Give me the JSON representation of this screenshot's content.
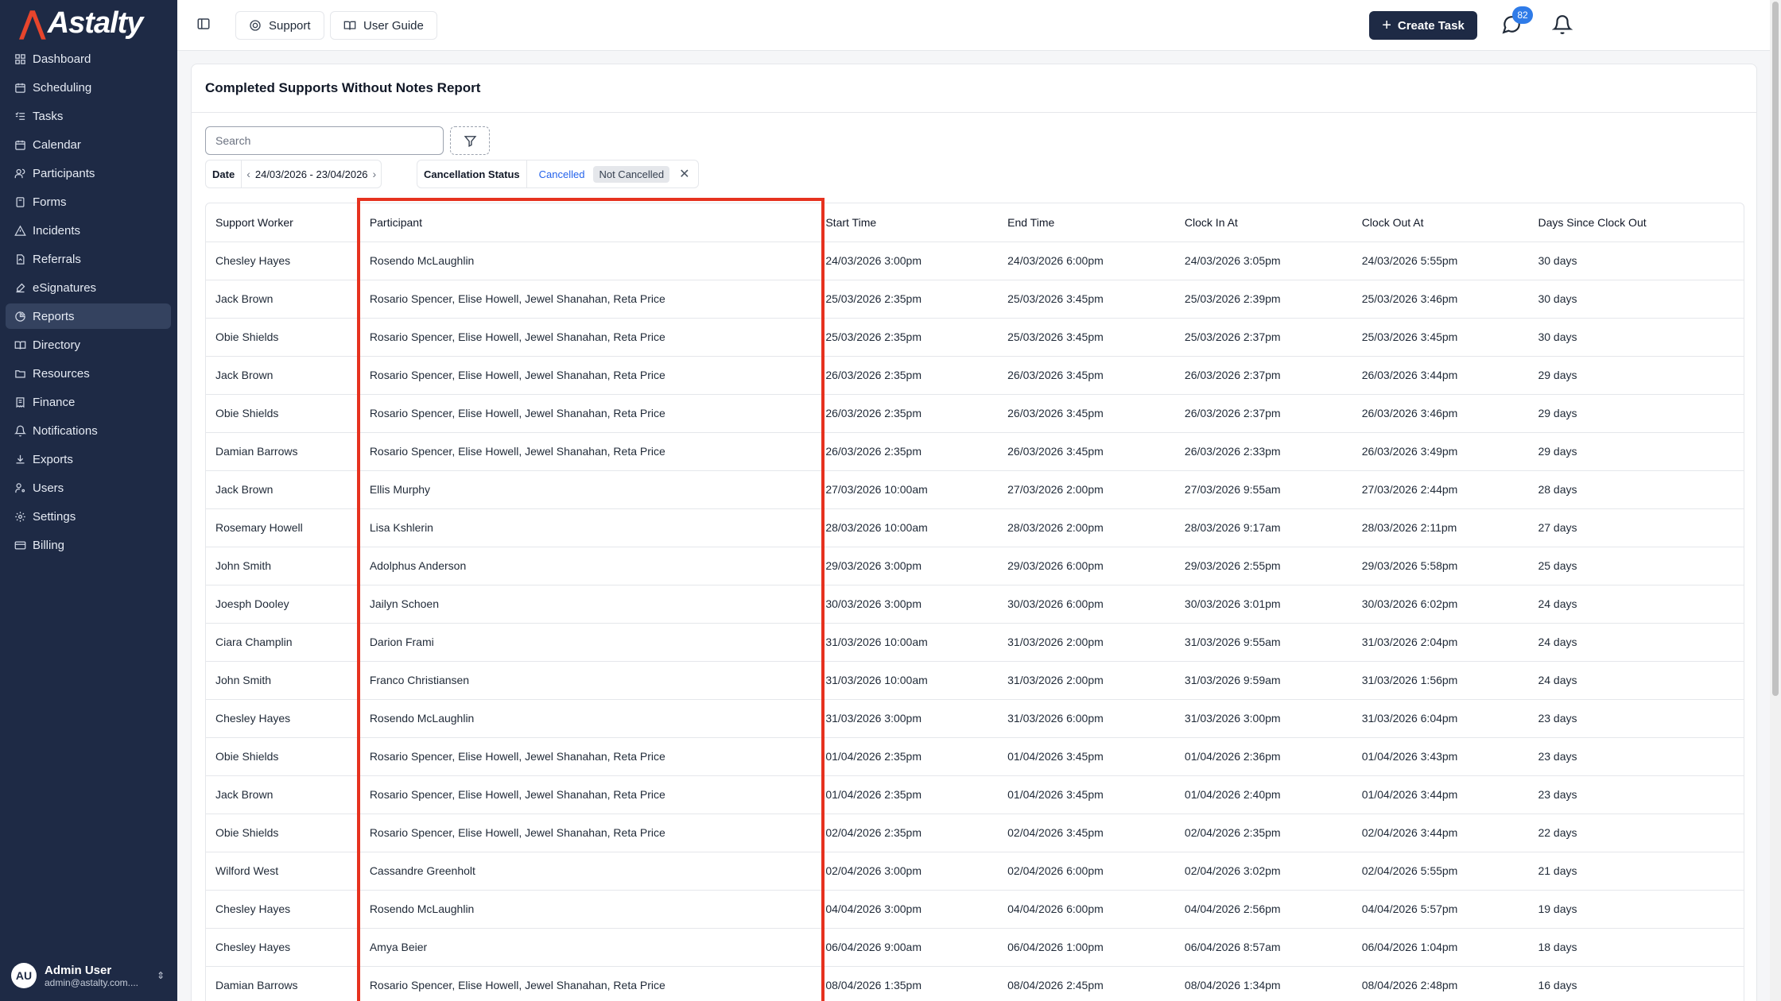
{
  "app": {
    "logo_text": "Astalty"
  },
  "sidebar": {
    "items": [
      {
        "label": "Dashboard",
        "icon": "dashboard-icon",
        "active": false
      },
      {
        "label": "Scheduling",
        "icon": "calendar-clock-icon",
        "active": false
      },
      {
        "label": "Tasks",
        "icon": "tasks-icon",
        "active": false
      },
      {
        "label": "Calendar",
        "icon": "calendar-icon",
        "active": false
      },
      {
        "label": "Participants",
        "icon": "users-icon",
        "active": false
      },
      {
        "label": "Forms",
        "icon": "form-icon",
        "active": false
      },
      {
        "label": "Incidents",
        "icon": "warning-icon",
        "active": false
      },
      {
        "label": "Referrals",
        "icon": "referral-icon",
        "active": false
      },
      {
        "label": "eSignatures",
        "icon": "signature-icon",
        "active": false
      },
      {
        "label": "Reports",
        "icon": "pie-chart-icon",
        "active": true
      },
      {
        "label": "Directory",
        "icon": "book-icon",
        "active": false
      },
      {
        "label": "Resources",
        "icon": "folder-icon",
        "active": false
      },
      {
        "label": "Finance",
        "icon": "receipt-icon",
        "active": false
      },
      {
        "label": "Notifications",
        "icon": "bell-icon",
        "active": false
      },
      {
        "label": "Exports",
        "icon": "download-icon",
        "active": false
      },
      {
        "label": "Users",
        "icon": "user-key-icon",
        "active": false
      },
      {
        "label": "Settings",
        "icon": "gear-icon",
        "active": false
      },
      {
        "label": "Billing",
        "icon": "credit-card-icon",
        "active": false
      }
    ],
    "user": {
      "initials": "AU",
      "name": "Admin User",
      "email": "admin@astalty.com...."
    }
  },
  "topbar": {
    "support_label": "Support",
    "guide_label": "User Guide",
    "create_label": "Create Task",
    "messages_count": "82"
  },
  "report": {
    "title": "Completed Supports Without Notes Report",
    "search_placeholder": "Search",
    "date_filter": {
      "label": "Date",
      "range": "24/03/2026 - 23/04/2026"
    },
    "status_filter": {
      "label": "Cancellation Status",
      "options": [
        "Cancelled",
        "Not Cancelled"
      ],
      "selected": "Not Cancelled"
    },
    "columns": [
      "Support Worker",
      "Participant",
      "Start Time",
      "End Time",
      "Clock In At",
      "Clock Out At",
      "Days Since Clock Out"
    ],
    "rows": [
      [
        "Chesley Hayes",
        "Rosendo McLaughlin",
        "24/03/2026 3:00pm",
        "24/03/2026 6:00pm",
        "24/03/2026 3:05pm",
        "24/03/2026 5:55pm",
        "30 days"
      ],
      [
        "Jack Brown",
        "Rosario Spencer, Elise Howell, Jewel Shanahan, Reta Price",
        "25/03/2026 2:35pm",
        "25/03/2026 3:45pm",
        "25/03/2026 2:39pm",
        "25/03/2026 3:46pm",
        "30 days"
      ],
      [
        "Obie Shields",
        "Rosario Spencer, Elise Howell, Jewel Shanahan, Reta Price",
        "25/03/2026 2:35pm",
        "25/03/2026 3:45pm",
        "25/03/2026 2:37pm",
        "25/03/2026 3:45pm",
        "30 days"
      ],
      [
        "Jack Brown",
        "Rosario Spencer, Elise Howell, Jewel Shanahan, Reta Price",
        "26/03/2026 2:35pm",
        "26/03/2026 3:45pm",
        "26/03/2026 2:37pm",
        "26/03/2026 3:44pm",
        "29 days"
      ],
      [
        "Obie Shields",
        "Rosario Spencer, Elise Howell, Jewel Shanahan, Reta Price",
        "26/03/2026 2:35pm",
        "26/03/2026 3:45pm",
        "26/03/2026 2:37pm",
        "26/03/2026 3:46pm",
        "29 days"
      ],
      [
        "Damian Barrows",
        "Rosario Spencer, Elise Howell, Jewel Shanahan, Reta Price",
        "26/03/2026 2:35pm",
        "26/03/2026 3:45pm",
        "26/03/2026 2:33pm",
        "26/03/2026 3:49pm",
        "29 days"
      ],
      [
        "Jack Brown",
        "Ellis Murphy",
        "27/03/2026 10:00am",
        "27/03/2026 2:00pm",
        "27/03/2026 9:55am",
        "27/03/2026 2:44pm",
        "28 days"
      ],
      [
        "Rosemary Howell",
        "Lisa Kshlerin",
        "28/03/2026 10:00am",
        "28/03/2026 2:00pm",
        "28/03/2026 9:17am",
        "28/03/2026 2:11pm",
        "27 days"
      ],
      [
        "John Smith",
        "Adolphus Anderson",
        "29/03/2026 3:00pm",
        "29/03/2026 6:00pm",
        "29/03/2026 2:55pm",
        "29/03/2026 5:58pm",
        "25 days"
      ],
      [
        "Joesph Dooley",
        "Jailyn Schoen",
        "30/03/2026 3:00pm",
        "30/03/2026 6:00pm",
        "30/03/2026 3:01pm",
        "30/03/2026 6:02pm",
        "24 days"
      ],
      [
        "Ciara Champlin",
        "Darion Frami",
        "31/03/2026 10:00am",
        "31/03/2026 2:00pm",
        "31/03/2026 9:55am",
        "31/03/2026 2:04pm",
        "24 days"
      ],
      [
        "John Smith",
        "Franco Christiansen",
        "31/03/2026 10:00am",
        "31/03/2026 2:00pm",
        "31/03/2026 9:59am",
        "31/03/2026 1:56pm",
        "24 days"
      ],
      [
        "Chesley Hayes",
        "Rosendo McLaughlin",
        "31/03/2026 3:00pm",
        "31/03/2026 6:00pm",
        "31/03/2026 3:00pm",
        "31/03/2026 6:04pm",
        "23 days"
      ],
      [
        "Obie Shields",
        "Rosario Spencer, Elise Howell, Jewel Shanahan, Reta Price",
        "01/04/2026 2:35pm",
        "01/04/2026 3:45pm",
        "01/04/2026 2:36pm",
        "01/04/2026 3:43pm",
        "23 days"
      ],
      [
        "Jack Brown",
        "Rosario Spencer, Elise Howell, Jewel Shanahan, Reta Price",
        "01/04/2026 2:35pm",
        "01/04/2026 3:45pm",
        "01/04/2026 2:40pm",
        "01/04/2026 3:44pm",
        "23 days"
      ],
      [
        "Obie Shields",
        "Rosario Spencer, Elise Howell, Jewel Shanahan, Reta Price",
        "02/04/2026 2:35pm",
        "02/04/2026 3:45pm",
        "02/04/2026 2:35pm",
        "02/04/2026 3:44pm",
        "22 days"
      ],
      [
        "Wilford West",
        "Cassandre Greenholt",
        "02/04/2026 3:00pm",
        "02/04/2026 6:00pm",
        "02/04/2026 3:02pm",
        "02/04/2026 5:55pm",
        "21 days"
      ],
      [
        "Chesley Hayes",
        "Rosendo McLaughlin",
        "04/04/2026 3:00pm",
        "04/04/2026 6:00pm",
        "04/04/2026 2:56pm",
        "04/04/2026 5:57pm",
        "19 days"
      ],
      [
        "Chesley Hayes",
        "Amya Beier",
        "06/04/2026 9:00am",
        "06/04/2026 1:00pm",
        "06/04/2026 8:57am",
        "06/04/2026 1:04pm",
        "18 days"
      ],
      [
        "Damian Barrows",
        "Rosario Spencer, Elise Howell, Jewel Shanahan, Reta Price",
        "08/04/2026 1:35pm",
        "08/04/2026 2:45pm",
        "08/04/2026 1:34pm",
        "08/04/2026 2:48pm",
        "16 days"
      ]
    ]
  },
  "colors": {
    "sidebar_bg": "#1e2a45",
    "accent": "#2f7be8",
    "highlight": "#e6321f"
  }
}
